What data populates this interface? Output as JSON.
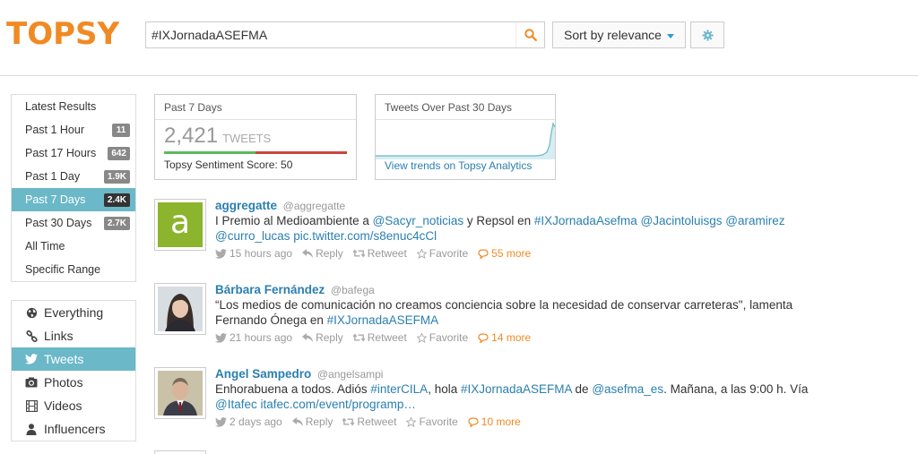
{
  "brand": {
    "logo": "TOPSY",
    "color": "#f08a24"
  },
  "search": {
    "value": "#IXJornadaASEFMA"
  },
  "sort": {
    "label": "Sort by relevance"
  },
  "time_filters": [
    {
      "label": "Latest Results",
      "badge": ""
    },
    {
      "label": "Past 1 Hour",
      "badge": "11"
    },
    {
      "label": "Past 17 Hours",
      "badge": "642"
    },
    {
      "label": "Past 1 Day",
      "badge": "1.9K"
    },
    {
      "label": "Past 7 Days",
      "badge": "2.4K",
      "active": true
    },
    {
      "label": "Past 30 Days",
      "badge": "2.7K"
    },
    {
      "label": "All Time",
      "badge": ""
    },
    {
      "label": "Specific Range",
      "badge": ""
    }
  ],
  "type_filters": [
    {
      "label": "Everything",
      "icon": "globe-icon"
    },
    {
      "label": "Links",
      "icon": "link-icon"
    },
    {
      "label": "Tweets",
      "icon": "twitter-bird-icon",
      "active": true
    },
    {
      "label": "Photos",
      "icon": "camera-icon"
    },
    {
      "label": "Videos",
      "icon": "film-icon"
    },
    {
      "label": "Influencers",
      "icon": "person-icon"
    }
  ],
  "stats": {
    "period": "Past 7 Days",
    "count": "2,421",
    "unit": "TWEETS",
    "sentiment_label": "Topsy Sentiment Score: 50",
    "sentiment_score": 50
  },
  "trend": {
    "title": "Tweets Over Past 30 Days",
    "link": "View trends on Topsy Analytics",
    "color": "#6bb8c8"
  },
  "tweets": [
    {
      "name": "aggregatte",
      "handle": "@aggregatte",
      "text_a": "I Premio al Medioambiente a ",
      "link_a": "@Sacyr_noticias",
      "text_b": " y Repsol en ",
      "link_b": "#IXJornadaAsefma",
      "text_c": " ",
      "link_c": "@Jacintoluisgs",
      "text_d": " ",
      "link_d": "@aramirez",
      "text_e": " ",
      "link_e": "@curro_lucas",
      "text_f": " ",
      "link_f": "pic.twitter.com/s8enuc4cCl",
      "time": "15 hours ago",
      "reply": "Reply",
      "retweet": "Retweet",
      "favorite": "Favorite",
      "more": "55 more"
    },
    {
      "name": "Bárbara Fernández",
      "handle": "@bafega",
      "text_a": "“Los medios de comunicación no creamos conciencia sobre la necesidad de conservar carreteras\", lamenta Fernando Ónega en ",
      "link_a": "#IXJornadaASEFMA",
      "time": "21 hours ago",
      "reply": "Reply",
      "retweet": "Retweet",
      "favorite": "Favorite",
      "more": "14 more"
    },
    {
      "name": "Angel Sampedro",
      "handle": "@angelsampi",
      "text_a": "Enhorabuena a todos. Adiós ",
      "link_a": "#interCILA",
      "text_b": ", hola ",
      "link_b": "#IXJornadaASEFMA",
      "text_c": " de ",
      "link_c": "@asefma_es",
      "text_d": ". Mañana, a las 9:00 h. Vía ",
      "link_d": "@Itafec",
      "text_e": " ",
      "link_e": "itafec.com/event/programp…",
      "time": "2 days ago",
      "reply": "Reply",
      "retweet": "Retweet",
      "favorite": "Favorite",
      "more": "10 more"
    }
  ]
}
